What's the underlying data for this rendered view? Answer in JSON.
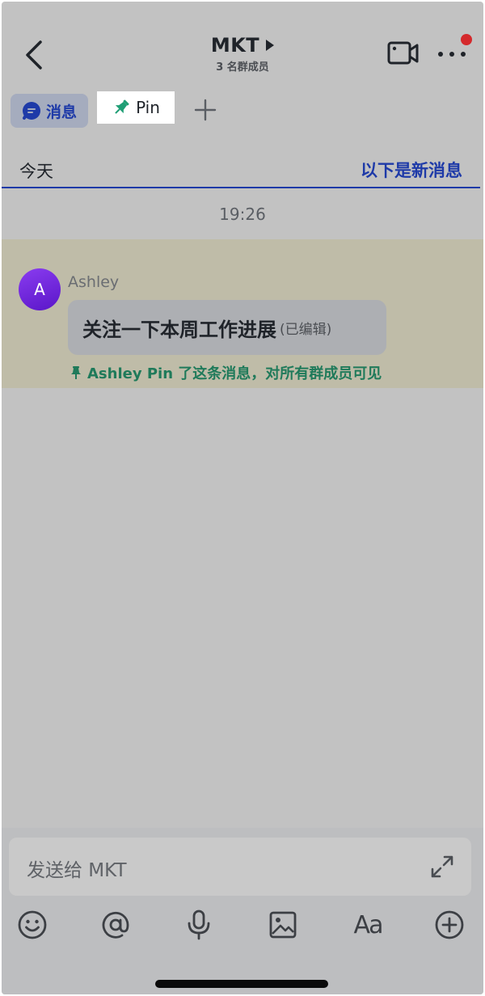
{
  "header": {
    "title": "MKT",
    "subtitle": "3 名群成员"
  },
  "tabs": {
    "messages_label": "消息",
    "pin_label": "Pin"
  },
  "date_row": {
    "today": "今天",
    "new_messages": "以下是新消息"
  },
  "timestamp": "19:26",
  "message": {
    "avatar_initial": "A",
    "sender": "Ashley",
    "text": "关注一下本周工作进展",
    "edited": "(已编辑)",
    "pin_notice": "Ashley Pin 了这条消息，对所有群成员可见"
  },
  "composer": {
    "placeholder": "发送给 MKT",
    "font_tool_label": "Aa"
  },
  "colors": {
    "accent": "#1e3aa8",
    "pin_green": "#1f7a5a",
    "notification_red": "#d4292c"
  }
}
